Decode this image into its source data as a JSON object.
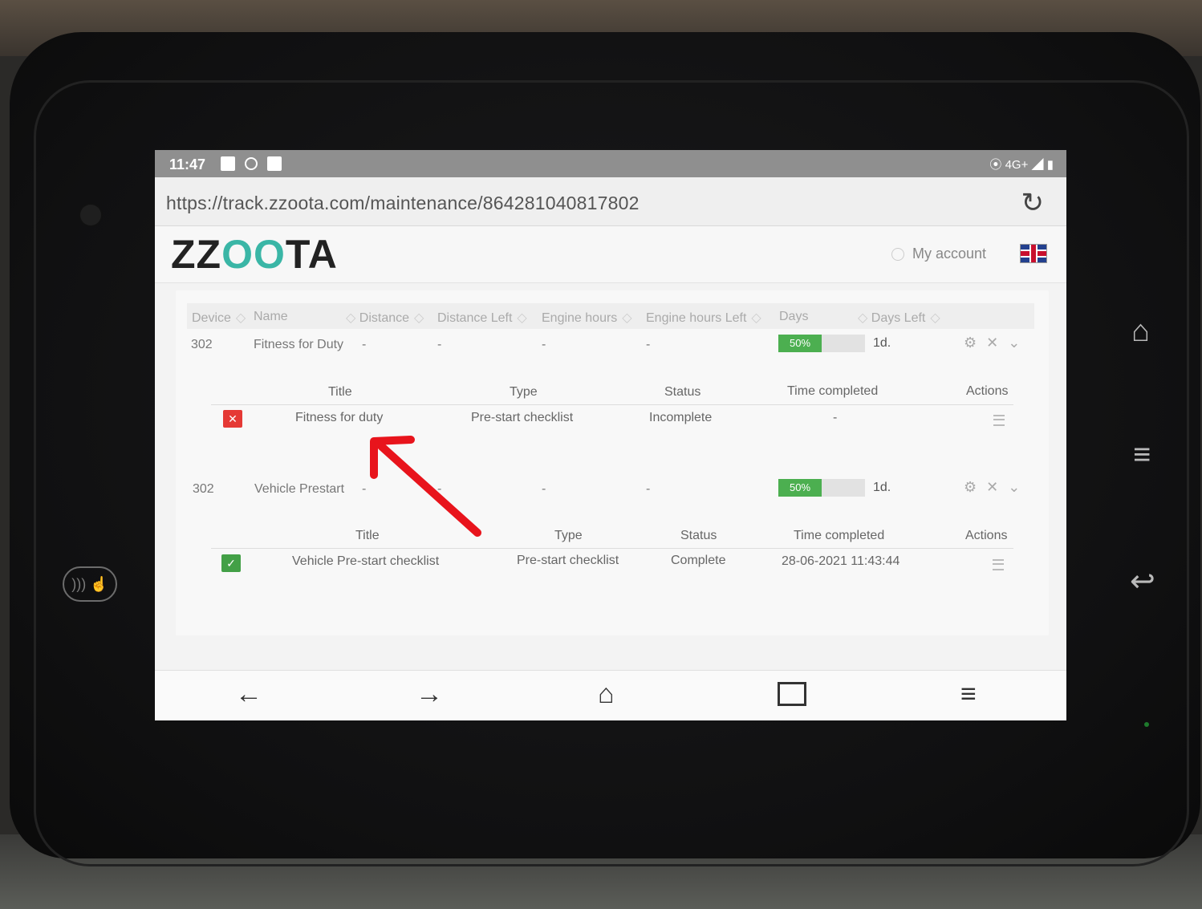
{
  "status_bar": {
    "time": "11:47",
    "network": "4G+"
  },
  "browser": {
    "url": "https://track.zzoota.com/maintenance/864281040817802"
  },
  "site": {
    "logo_prefix": "ZZ",
    "logo_oo": "OO",
    "logo_suffix": "TA",
    "account_label": "My account"
  },
  "table": {
    "columns": [
      "Device",
      "Name",
      "Distance",
      "Distance Left",
      "Engine hours",
      "Engine hours Left",
      "Days",
      "Days Left"
    ],
    "rows": [
      {
        "device": "302",
        "name": "Fitness for Duty",
        "distance": "-",
        "distance_left": "-",
        "engine_hours": "-",
        "engine_hours_left": "-",
        "days_progress": "50%",
        "days_left": "1d.",
        "sub_columns": [
          "Title",
          "Type",
          "Status",
          "Time completed",
          "Actions"
        ],
        "sub_row": {
          "status_icon": "cross",
          "title": "Fitness for duty",
          "type": "Pre-start checklist",
          "status": "Incomplete",
          "time_completed": "-"
        }
      },
      {
        "device": "302",
        "name": "Vehicle Prestart",
        "distance": "-",
        "distance_left": "-",
        "engine_hours": "-",
        "engine_hours_left": "-",
        "days_progress": "50%",
        "days_left": "1d.",
        "sub_columns": [
          "Title",
          "Type",
          "Status",
          "Time completed",
          "Actions"
        ],
        "sub_row": {
          "status_icon": "check",
          "title": "Vehicle Pre-start checklist",
          "type": "Pre-start checklist",
          "status": "Complete",
          "time_completed": "28-06-2021 11:43:44"
        }
      }
    ]
  },
  "colors": {
    "incomplete": "#e53935",
    "complete": "#43a047",
    "progress": "#4caf50",
    "annotation_arrow": "#e8141c"
  }
}
